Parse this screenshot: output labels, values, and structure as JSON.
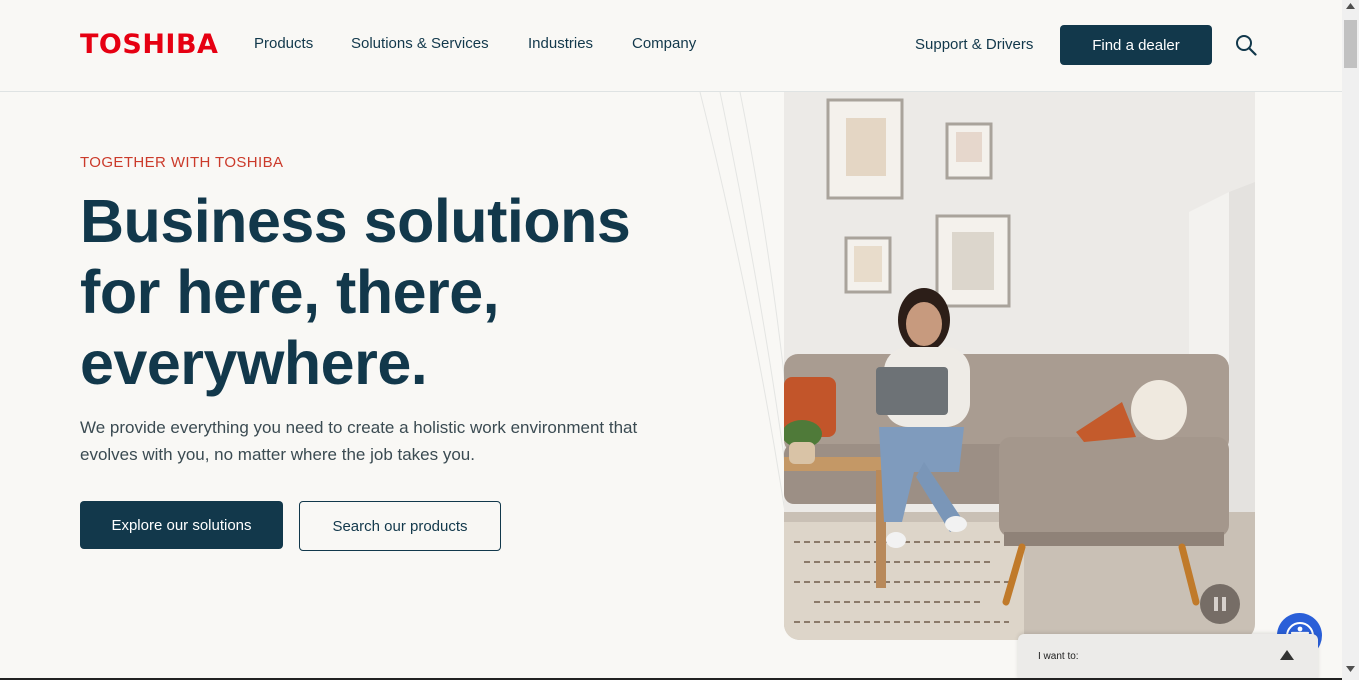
{
  "header": {
    "logo": "TOSHIBA",
    "nav": [
      "Products",
      "Solutions & Services",
      "Industries",
      "Company"
    ],
    "support_link": "Support & Drivers",
    "dealer_button": "Find a dealer",
    "search_icon": "search-icon"
  },
  "hero": {
    "eyebrow": "TOGETHER WITH TOSHIBA",
    "headline": "Business solutions for here, there, everywhere.",
    "subtext": "We provide everything you need to create a holistic work environment that evolves with you, no matter where the job takes you.",
    "primary_button": "Explore our solutions",
    "secondary_button": "Search our products",
    "image_alt": "woman-with-laptop-on-sofa-photo",
    "pause_icon": "pause-icon"
  },
  "widget": {
    "label": "I want to:",
    "caret_icon": "caret-up-icon",
    "accessibility_icon": "accessibility-icon"
  },
  "colors": {
    "brand_red": "#e60012",
    "navy": "#12384b",
    "background": "#f9f8f5",
    "eyebrow_red": "#cb3a2a",
    "accessibility_blue": "#2a5fd8"
  }
}
